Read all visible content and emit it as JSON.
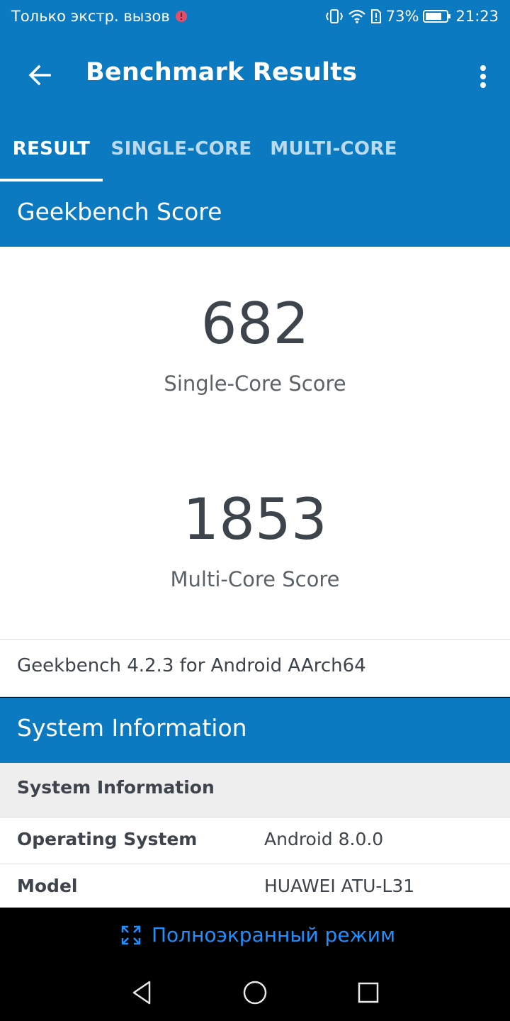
{
  "status_bar": {
    "carrier_text": "Только экстр. вызов",
    "battery_percent": "73%",
    "time": "21:23",
    "icons": [
      "alert-icon",
      "vibrate-icon",
      "wifi-icon",
      "sim-alert-icon",
      "battery-icon"
    ]
  },
  "app_bar": {
    "title": "Benchmark Results",
    "back_icon": "arrow-back-icon",
    "menu_icon": "more-vert-icon"
  },
  "tabs": [
    {
      "label": "RESULT",
      "selected": true
    },
    {
      "label": "SINGLE-CORE",
      "selected": false
    },
    {
      "label": "MULTI-CORE",
      "selected": false
    }
  ],
  "geekbench": {
    "header": "Geekbench Score",
    "single_core": {
      "value": "682",
      "label": "Single-Core Score"
    },
    "multi_core": {
      "value": "1853",
      "label": "Multi-Core Score"
    },
    "version": "Geekbench 4.2.3 for Android AArch64"
  },
  "system_info": {
    "header": "System Information",
    "subheader": "System Information",
    "rows": [
      {
        "key": "Operating System",
        "value": "Android 8.0.0"
      },
      {
        "key": "Model",
        "value": "HUAWEI ATU-L31"
      }
    ]
  },
  "fullscreen": {
    "label": "Полноэкранный режим",
    "icon": "fullscreen-icon"
  },
  "colors": {
    "primary": "#0B7AC0",
    "text_dark": "#3D444B",
    "link_blue": "#1E90FF"
  }
}
